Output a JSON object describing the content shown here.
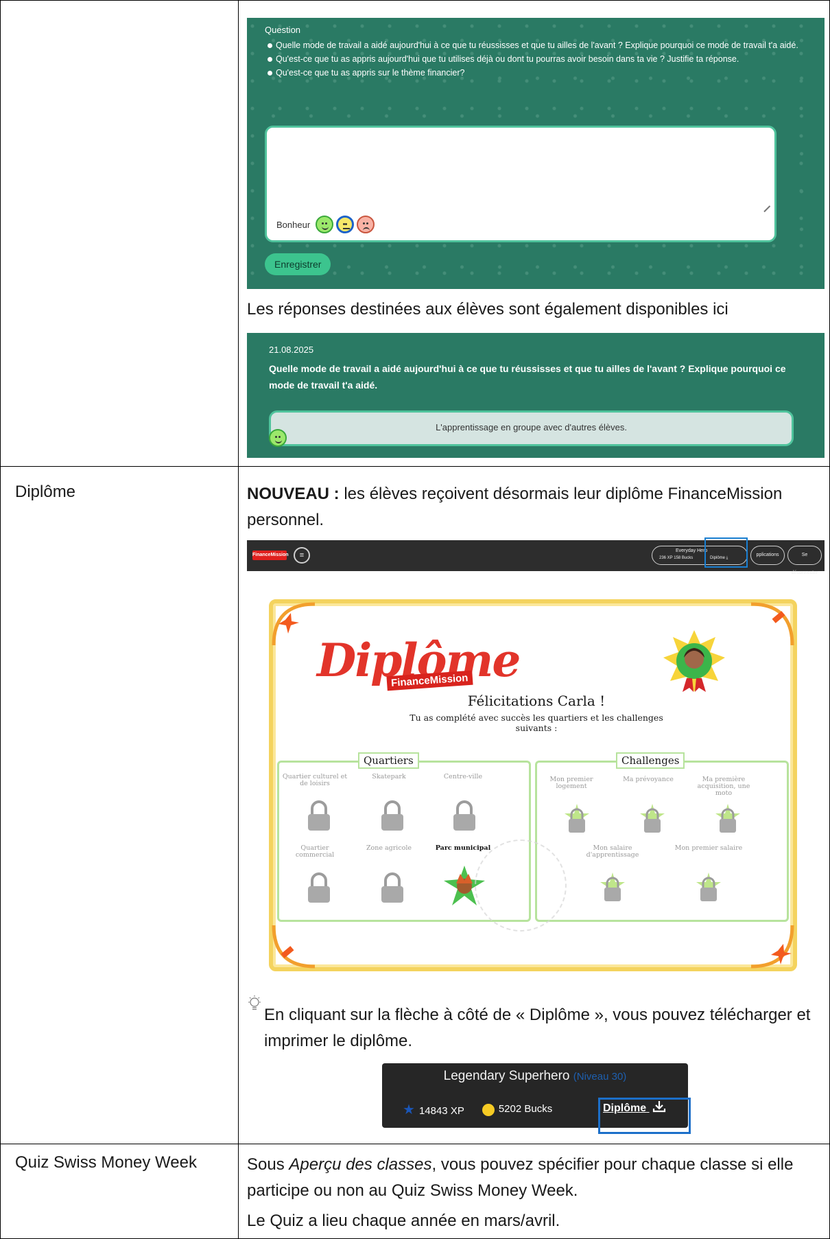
{
  "reflection_panel": {
    "heading": "Question",
    "questions": [
      "Quelle mode de travail a aidé aujourd'hui à ce que tu réussisses et que tu ailles de l'avant ? Explique pourquoi ce mode de travail t'a aidé.",
      "Qu'est-ce que tu as appris aujourd'hui que tu utilises déjà ou dont tu pourras avoir besoin dans ta vie ? Justifie ta réponse.",
      "Qu'est-ce que tu as appris sur le thème financier?"
    ],
    "mood_label": "Bonheur",
    "save_label": "Enregistrer"
  },
  "answers_intro": "Les réponses destinées aux élèves sont également disponibles ici",
  "answers_panel": {
    "date": "21.08.2025",
    "question": "Quelle mode de travail a aidé aujourd'hui à ce que tu réussisses et que tu ailles de l'avant ? Explique pourquoi ce mode de travail t'a aidé.",
    "answer": "L'apprentissage en groupe avec d'autres élèves."
  },
  "row_diplome": {
    "label": "Diplôme",
    "new_prefix": "NOUVEAU :",
    "intro": " les élèves reçoivent désormais leur diplôme FinanceMission personnel.",
    "nav": {
      "logo": "FinanceMission",
      "menu_icon": "≡",
      "profile_title": "Everyday Hero",
      "profile_stats": "236 XP   158 Bucks",
      "diplome_link": "Diplôme ⤓",
      "apps_label": "pplications",
      "logout_label": "Se déconnecter"
    },
    "diploma": {
      "title": "Diplôme",
      "brand": "FinanceMission",
      "congrats": "Félicitations Carla !",
      "subtitle": "Tu as complété avec succès les quartiers et les challenges suivants :",
      "quartiers_title": "Quartiers",
      "challenges_title": "Challenges",
      "quartiers": [
        "Quartier culturel et de loisirs",
        "Skatepark",
        "Centre-ville",
        "Quartier commercial",
        "Zone agricole",
        "Parc municipal"
      ],
      "challenges": [
        "Mon premier logement",
        "Ma prévoyance",
        "Ma première acquisition, une moto",
        "Mon salaire d'apprentissage",
        "Mon premier salaire"
      ]
    },
    "tip": "En cliquant sur la flèche à côté de « Diplôme », vous pouvez télécharger et imprimer le diplôme.",
    "badge": {
      "title": "Legendary Superhero",
      "level": "(Niveau 30)",
      "xp": "14843 XP",
      "bucks": "5202 Bucks",
      "download": "Diplôme"
    }
  },
  "row_quiz": {
    "label": "Quiz Swiss Money Week",
    "text_a": "Sous ",
    "text_em": "Aperçu des classes",
    "text_b": ", vous pouvez spécifier pour chaque classe si elle participe ou non au Quiz Swiss Money Week.",
    "text2": "Le Quiz a lieu chaque année en mars/avril."
  },
  "colors": {
    "panel_green": "#2a7a64",
    "accent_green": "#4fc39c",
    "highlight_blue": "#1a7fd1"
  }
}
